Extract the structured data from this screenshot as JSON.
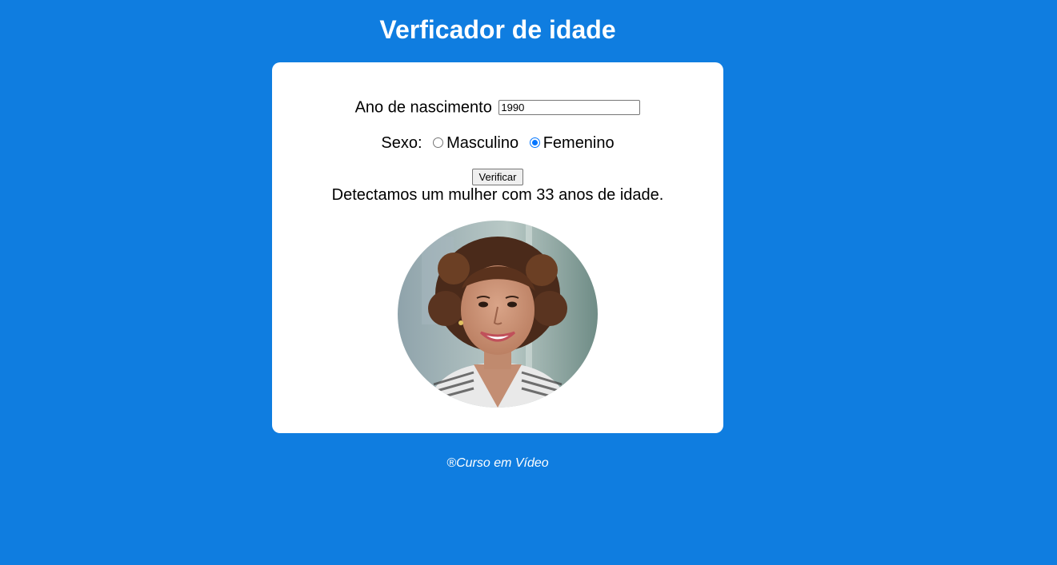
{
  "header": {
    "title": "Verficador de idade"
  },
  "form": {
    "year_label": "Ano de nascimento",
    "year_value": "1990",
    "sex_label": "Sexo:",
    "options": [
      {
        "label": "Masculino",
        "checked": false
      },
      {
        "label": "Femenino",
        "checked": true
      }
    ],
    "button_label": "Verificar"
  },
  "result": {
    "text": "Detectamos um mulher com 33 anos de idade."
  },
  "footer": {
    "text": "®Curso em Vídeo"
  },
  "colors": {
    "background": "#0f7de0",
    "card": "#ffffff",
    "radio_accent": "#0075ff"
  }
}
